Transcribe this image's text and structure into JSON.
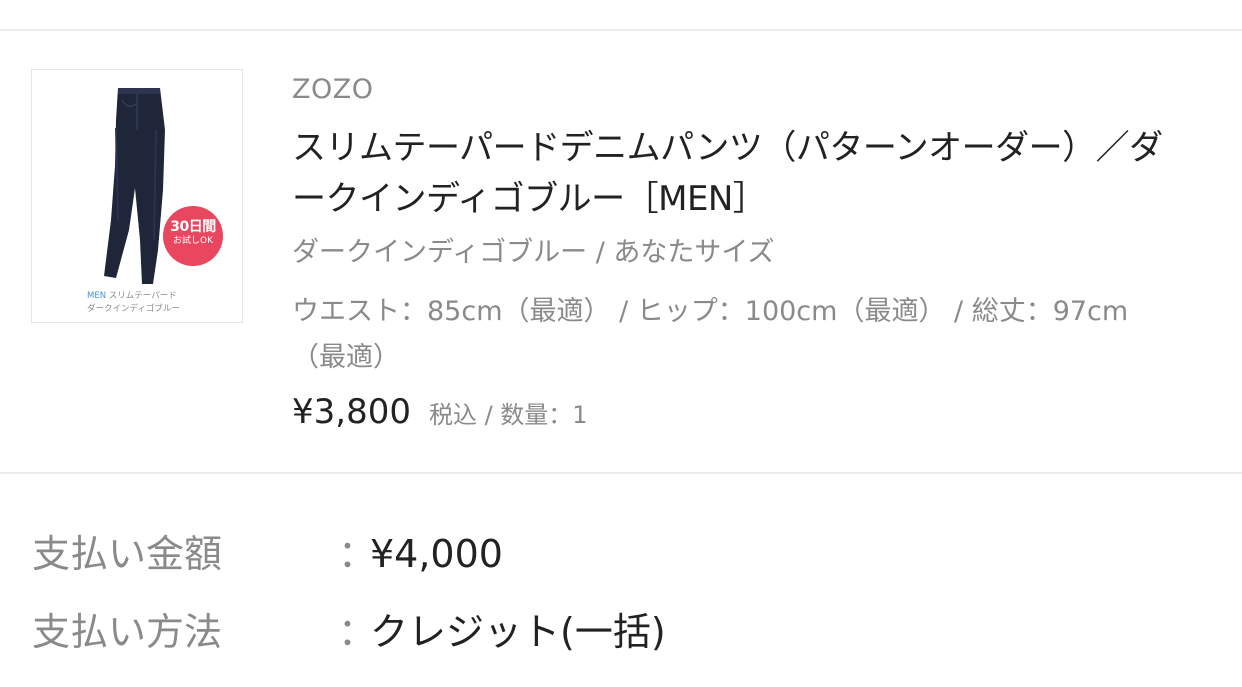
{
  "product": {
    "thumbnail": {
      "badge_line1": "30日間",
      "badge_line2": "お試しOK",
      "caption_tag": "MEN",
      "caption_line1": "スリムテーパード",
      "caption_line2": "ダークインディゴブルー",
      "badge_color": "#e8475f",
      "denim_color": "#1f2639"
    },
    "brand": "ZOZO",
    "title": "スリムテーパードデニムパンツ（パターンオーダー）／ダークインディゴブルー［MEN］",
    "variant": "ダークインディゴブルー / あなたサイズ",
    "sizes": "ウエスト：85cm（最適） / ヒップ：100cm（最適） / 総丈：97cm（最適）",
    "price": "¥3,800",
    "price_note": "税込 / 数量：1"
  },
  "payment": {
    "amount_label": "支払い金額",
    "amount_colon": "：",
    "amount_value": "¥4,000",
    "method_label": "支払い方法",
    "method_colon": "：",
    "method_value": "クレジット(一括)"
  }
}
